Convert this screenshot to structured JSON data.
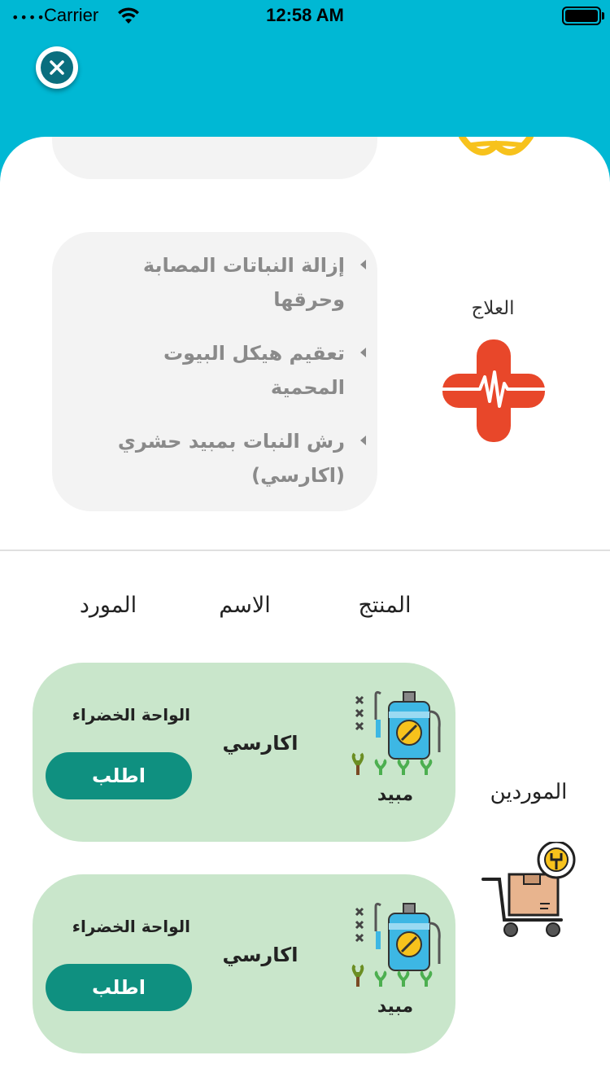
{
  "status_bar": {
    "carrier": "Carrier",
    "time": "12:58 AM",
    "signal": "••••"
  },
  "treatment": {
    "title": "العلاج",
    "items": [
      "إزالة النباتات المصابة وحرقها",
      "تعقيم هيكل البيوت المحمية",
      "رش النبات بمبيد حشري (اكارسي)"
    ]
  },
  "table_headers": {
    "product": "المنتج",
    "name": "الاسم",
    "supplier": "المورد"
  },
  "suppliers_section": {
    "title": "الموردين"
  },
  "cards": [
    {
      "product_type": "مبيد",
      "product_name": "اكارسي",
      "supplier_name": "الواحة الخضراء",
      "order_label": "اطلب"
    },
    {
      "product_type": "مبيد",
      "product_name": "اكارسي",
      "supplier_name": "الواحة الخضراء",
      "order_label": "اطلب"
    }
  ],
  "colors": {
    "header": "#00B8D4",
    "card_bg": "#C9E6CB",
    "order_button": "#0F9080",
    "treatment_icon": "#E8472A",
    "panel_bg": "#F3F3F3"
  },
  "icons": {
    "close": "close-icon",
    "treatment": "medical-cross-icon",
    "suppliers": "delivery-cart-icon",
    "product": "sprayer-icon"
  }
}
